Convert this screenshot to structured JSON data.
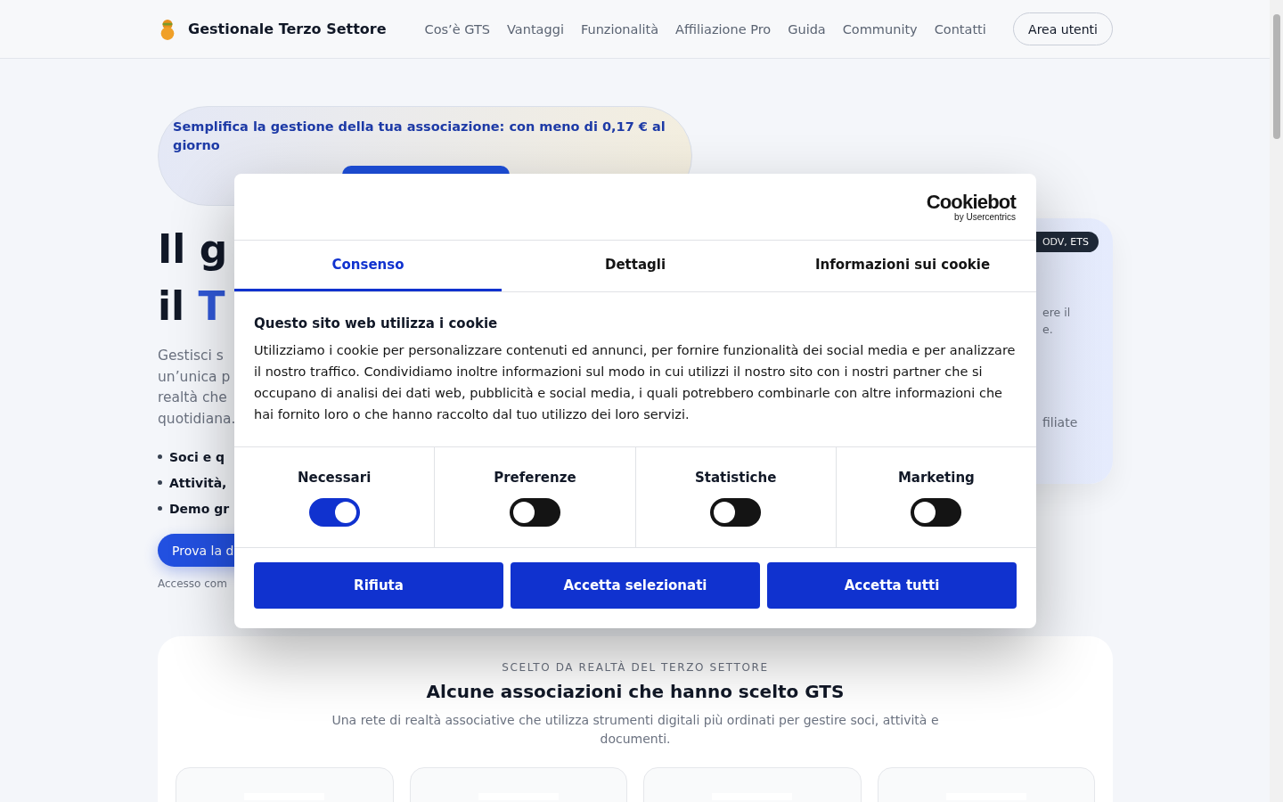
{
  "header": {
    "brand": "Gestionale Terzo Settore",
    "nav": [
      {
        "label": "Cos’è GTS"
      },
      {
        "label": "Vantaggi"
      },
      {
        "label": "Funzionalità"
      },
      {
        "label": "Affiliazione Pro"
      },
      {
        "label": "Guida"
      },
      {
        "label": "Community"
      },
      {
        "label": "Contatti"
      }
    ],
    "login_button": "Area utenti"
  },
  "hero": {
    "banner": "Semplifica la gestione della tua associazione: con meno di 0,17 € al giorno",
    "title_line_1": "Il g",
    "title_line_2_plain": "il ",
    "title_line_2_accent": "T",
    "intro_lines": [
      "Gestisci s",
      "un’unica p",
      "realtà che",
      "quotidiana."
    ],
    "bullets": [
      "Soci e q",
      "Attività,",
      "Demo gr"
    ],
    "cta_button": "Prova la d",
    "cta_note": "Accesso com"
  },
  "side_card": {
    "badge": "ODV, ETS",
    "text_lines": [
      "ere il",
      "e."
    ],
    "footer_text": "filiate"
  },
  "clients": {
    "kicker": "SCELTO DA REALTÀ DEL TERZO SETTORE",
    "title": "Alcune associazioni che hanno scelto GTS",
    "subtitle": "Una rete di realtà associative che utilizza strumenti digitali più ordinati per gestire soci, attività e documenti."
  },
  "cookie_dialog": {
    "logo": "Cookiebot",
    "logo_sub": "by Usercentrics",
    "tabs": [
      {
        "label": "Consenso",
        "selected": true
      },
      {
        "label": "Dettagli",
        "selected": false
      },
      {
        "label": "Informazioni sui cookie",
        "selected": false
      }
    ],
    "heading": "Questo sito web utilizza i cookie",
    "body": "Utilizziamo i cookie per personalizzare contenuti ed annunci, per fornire funzionalità dei social media e per analizzare il nostro traffico. Condividiamo inoltre informazioni sul modo in cui utilizzi il nostro sito con i nostri partner che si occupano di analisi dei dati web, pubblicità e social media, i quali potrebbero combinarle con altre informazioni che hai fornito loro o che hanno raccolto dal tuo utilizzo dei loro servizi.",
    "categories": [
      {
        "label": "Necessari",
        "checked": true
      },
      {
        "label": "Preferenze",
        "checked": false
      },
      {
        "label": "Statistiche",
        "checked": false
      },
      {
        "label": "Marketing",
        "checked": false
      }
    ],
    "buttons": [
      "Rifiuta",
      "Accetta selezionati",
      "Accetta tutti"
    ]
  }
}
